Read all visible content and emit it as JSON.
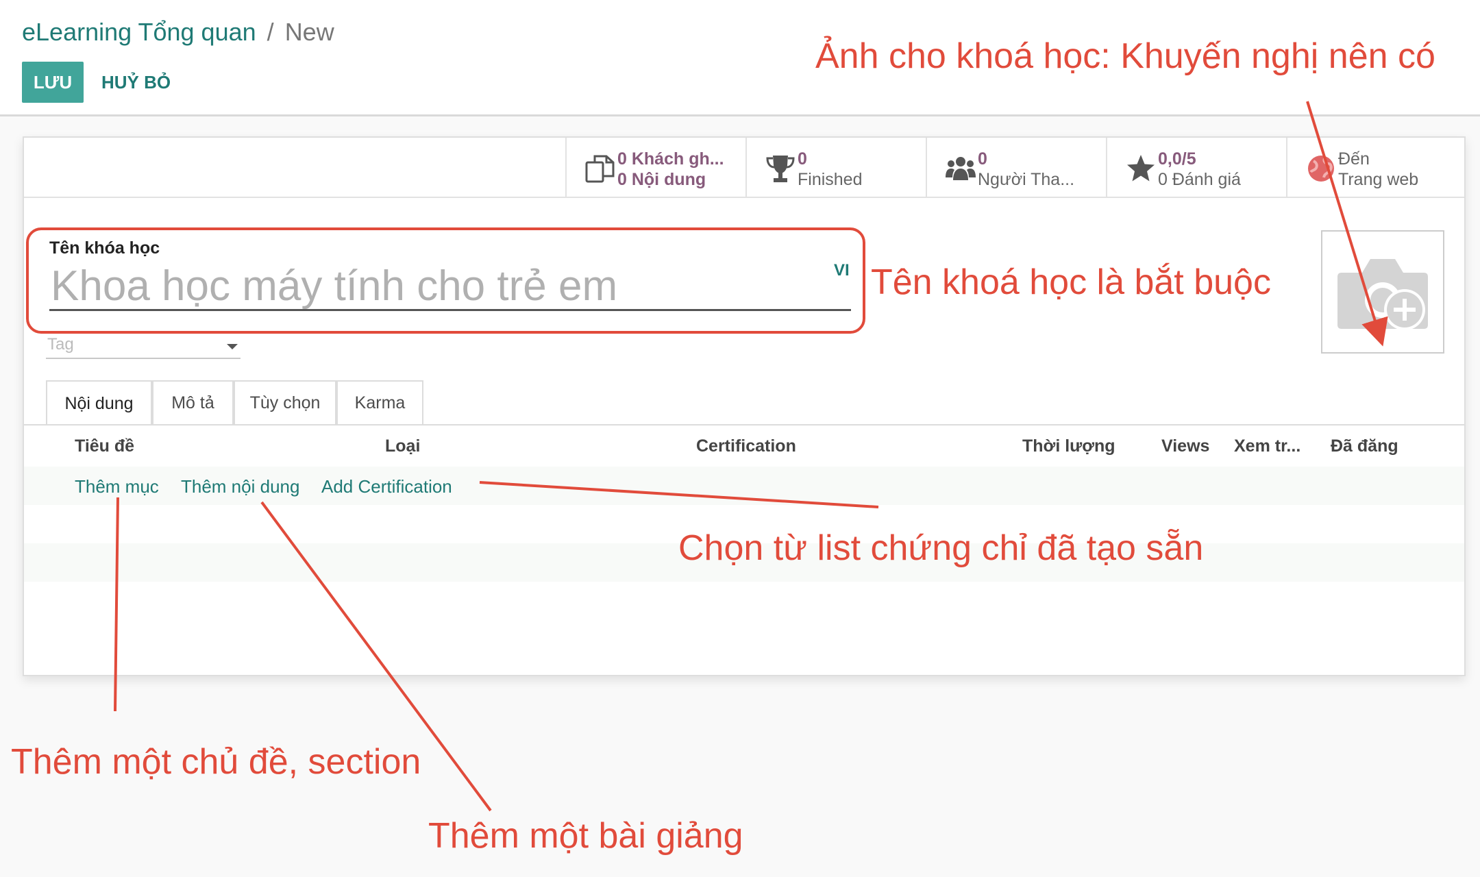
{
  "breadcrumb": {
    "root": "eLearning Tổng quan",
    "separator": "/",
    "current": "New"
  },
  "toolbar": {
    "save_label": "LƯU",
    "cancel_label": "HUỶ BỎ"
  },
  "smart_buttons": {
    "invite": {
      "line1": "0 Khách gh...",
      "line2": "0 Nội dung",
      "icon": "copy-icon"
    },
    "finished": {
      "line1": "0",
      "line2": "Finished",
      "icon": "trophy-icon"
    },
    "attendees": {
      "line1": "0",
      "line2": "Người Tha...",
      "icon": "users-icon"
    },
    "rating": {
      "line1": "0,0/5",
      "line2": "0 Đánh giá",
      "icon": "star-icon"
    },
    "website": {
      "line1": "Đến",
      "line2": "Trang web",
      "icon": "globe-icon"
    }
  },
  "form": {
    "name_label": "Tên khóa học",
    "name_placeholder": "Khoa học máy tính cho trẻ em",
    "lang": "VI",
    "tag_placeholder": "Tag"
  },
  "tabs": [
    "Nội dung",
    "Mô tả",
    "Tùy chọn",
    "Karma"
  ],
  "table": {
    "columns": [
      "Tiêu đề",
      "Loại",
      "Certification",
      "Thời lượng",
      "Views",
      "Xem tr...",
      "Đã đăng"
    ]
  },
  "actions": {
    "add_section": "Thêm mục",
    "add_content": "Thêm nội dung",
    "add_certification": "Add Certification"
  },
  "annotations": {
    "image_note": "Ảnh cho khoá học: Khuyến nghị nên có",
    "name_note": "Tên khoá học là bắt buộc",
    "cert_note": "Chọn từ list chứng chỉ đã tạo sẵn",
    "section_note": "Thêm một chủ đề, section",
    "lesson_note": "Thêm một bài giảng"
  },
  "colors": {
    "brand": "#41a59a",
    "link": "#1f7a75",
    "purple": "#875a7b",
    "annotation": "#e14b3b"
  }
}
